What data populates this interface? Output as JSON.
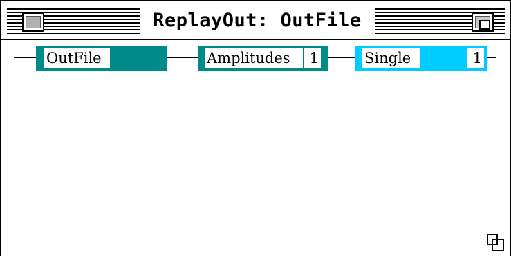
{
  "window": {
    "title": "ReplayOut: OutFile"
  },
  "chain": {
    "blocks": [
      {
        "label": "OutFile",
        "color": "#008b8b"
      },
      {
        "label": "Amplitudes",
        "value": "1",
        "color": "#008b8b"
      },
      {
        "label": "Single",
        "value": "1",
        "color": "#00ccff"
      }
    ]
  },
  "icons": {
    "close": "close-box-icon",
    "zoom": "zoom-box-icon",
    "grow": "grow-box-icon"
  }
}
